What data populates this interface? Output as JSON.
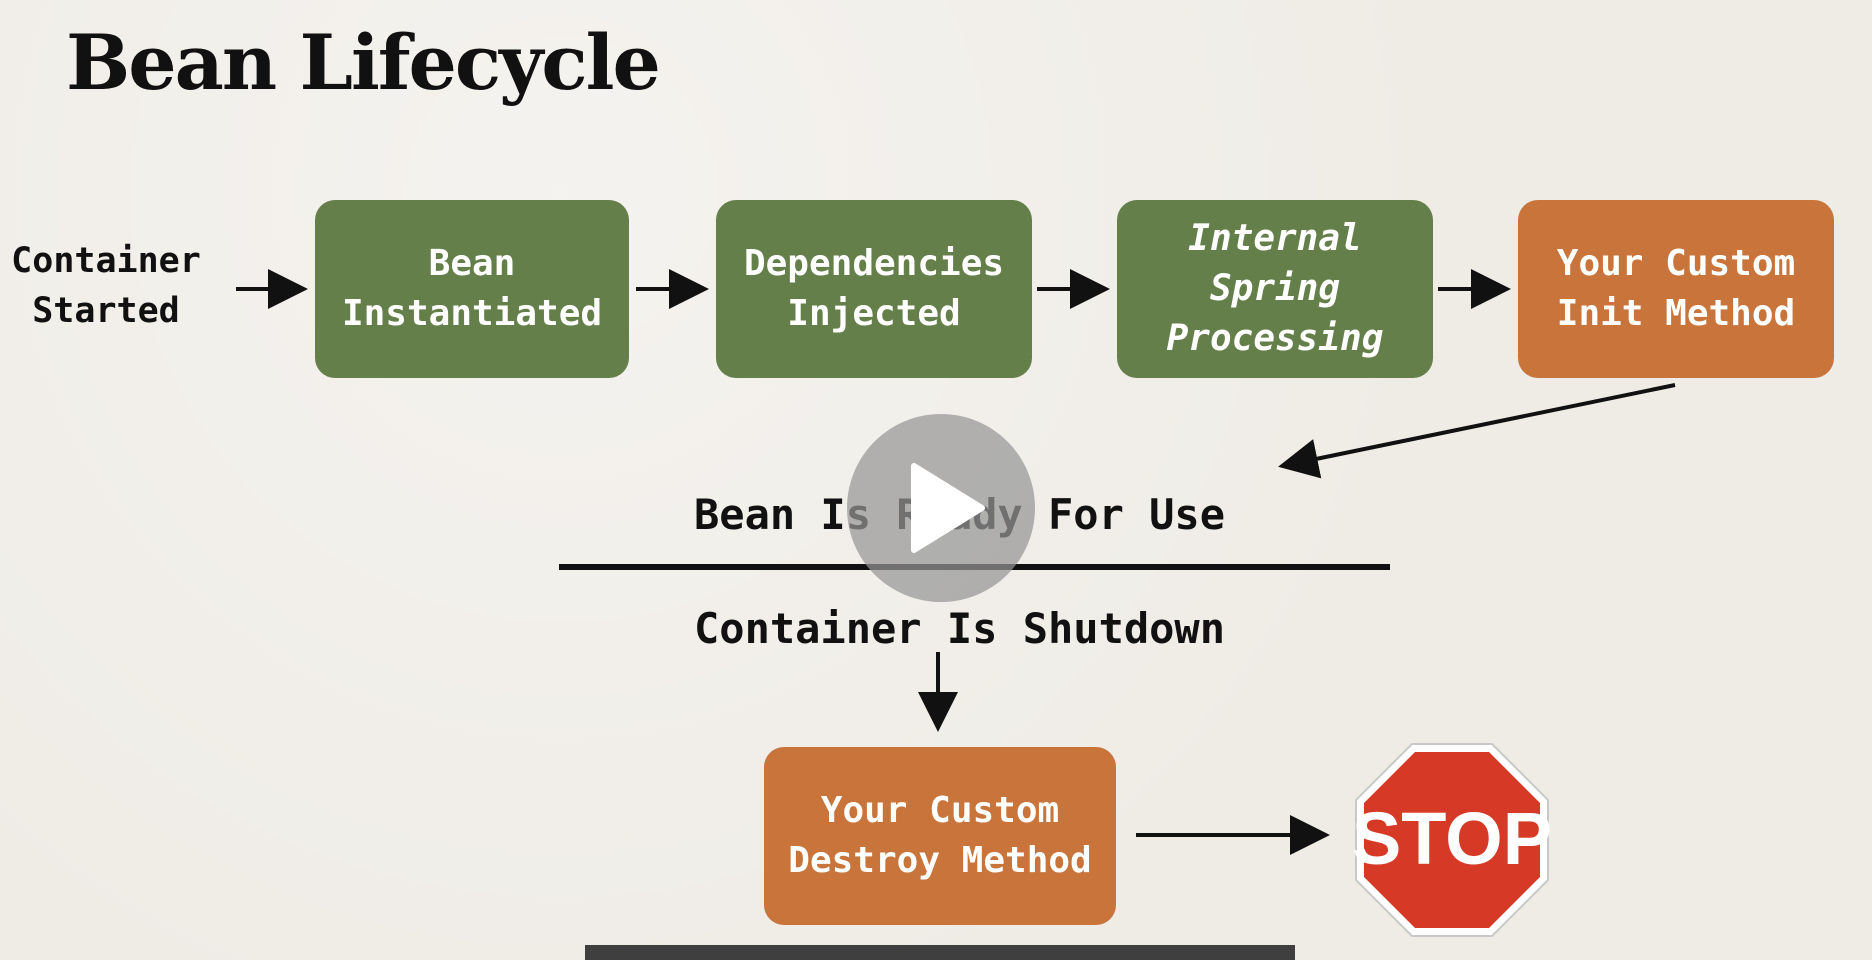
{
  "title": "Bean Lifecycle",
  "start_label": "Container\nStarted",
  "steps": [
    {
      "label": "Bean\nInstantiated"
    },
    {
      "label": "Dependencies\nInjected"
    },
    {
      "label": "Internal\nSpring\nProcessing"
    },
    {
      "label": "Your Custom\nInit Method"
    }
  ],
  "ready_label": "Bean Is Ready For Use",
  "shutdown_label": "Container Is Shutdown",
  "destroy_label": "Your Custom\nDestroy Method",
  "stop_sign_text": "STOP",
  "colors": {
    "green_box": "#657f4b",
    "orange_box": "#c8743a",
    "stop_red": "#d63a26",
    "background": "#efece6"
  },
  "icons": {
    "play": "play-icon",
    "stop": "stop-sign-icon"
  }
}
